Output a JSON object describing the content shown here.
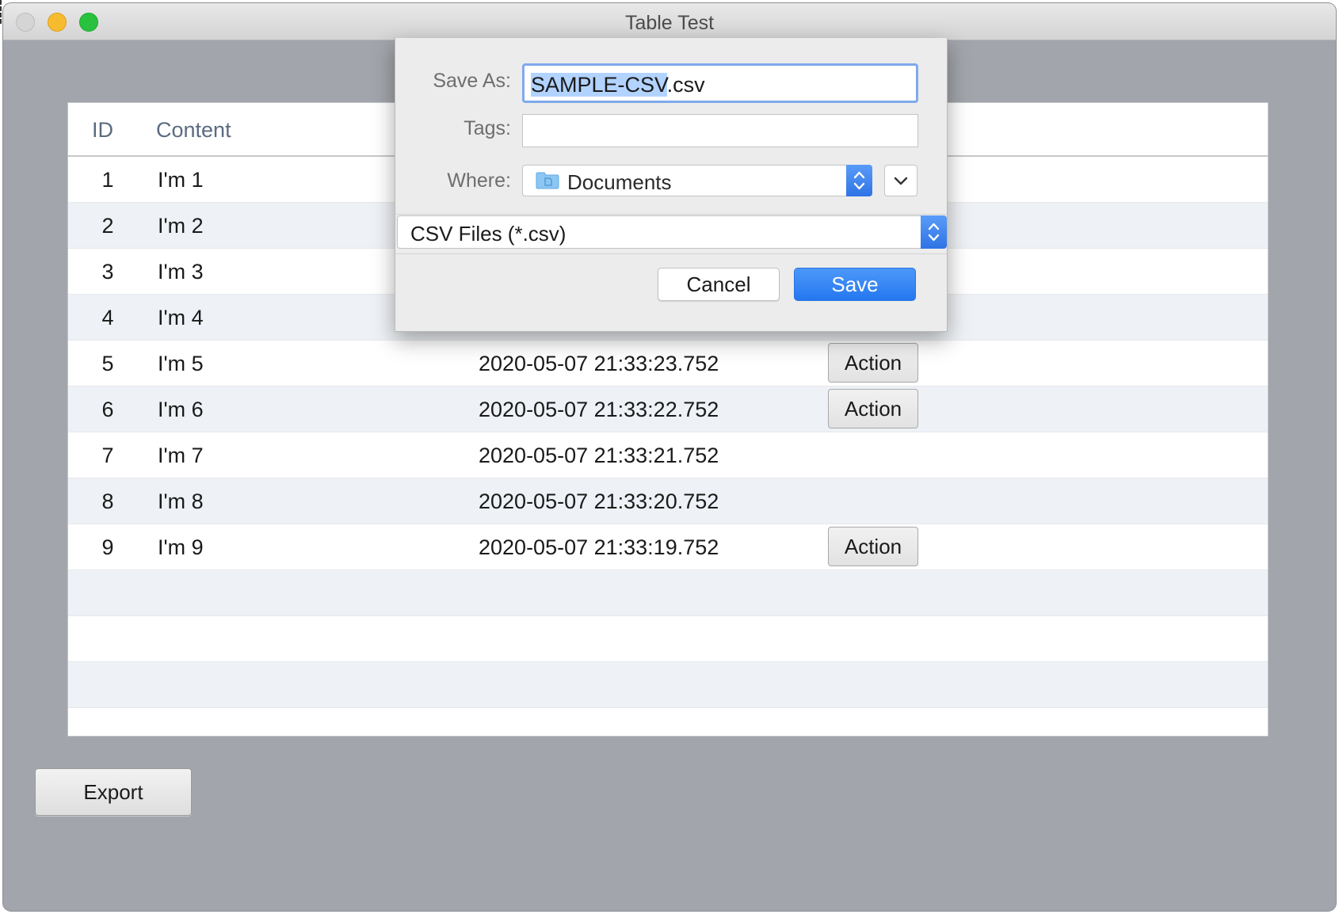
{
  "window": {
    "title": "Table Test"
  },
  "table": {
    "columns": {
      "id": "ID",
      "content": "Content"
    },
    "rows": [
      {
        "id": "1",
        "content": "I'm 1",
        "date": "",
        "action": ""
      },
      {
        "id": "2",
        "content": "I'm 2",
        "date": "",
        "action": ""
      },
      {
        "id": "3",
        "content": "I'm 3",
        "date": "",
        "action": ""
      },
      {
        "id": "4",
        "content": "I'm 4",
        "date": "",
        "action": ""
      },
      {
        "id": "5",
        "content": "I'm 5",
        "date": "2020-05-07 21:33:23.752",
        "action": "Action"
      },
      {
        "id": "6",
        "content": "I'm 6",
        "date": "2020-05-07 21:33:22.752",
        "action": "Action"
      },
      {
        "id": "7",
        "content": "I'm 7",
        "date": "2020-05-07 21:33:21.752",
        "action": ""
      },
      {
        "id": "8",
        "content": "I'm 8",
        "date": "2020-05-07 21:33:20.752",
        "action": ""
      },
      {
        "id": "9",
        "content": "I'm 9",
        "date": "2020-05-07 21:33:19.752",
        "action": "Action"
      }
    ]
  },
  "export_button": {
    "label": "Export"
  },
  "save_dialog": {
    "save_as_label": "Save As:",
    "filename_selected": "SAMPLE-CSV",
    "filename_extension": ".csv",
    "tags_label": "Tags:",
    "tags_value": "",
    "where_label": "Where:",
    "where_value": "Documents",
    "where_icon": "folder-icon",
    "format_value": "CSV Files (*.csv)",
    "cancel_label": "Cancel",
    "save_label": "Save",
    "accent_color": "#2f7bf0"
  }
}
